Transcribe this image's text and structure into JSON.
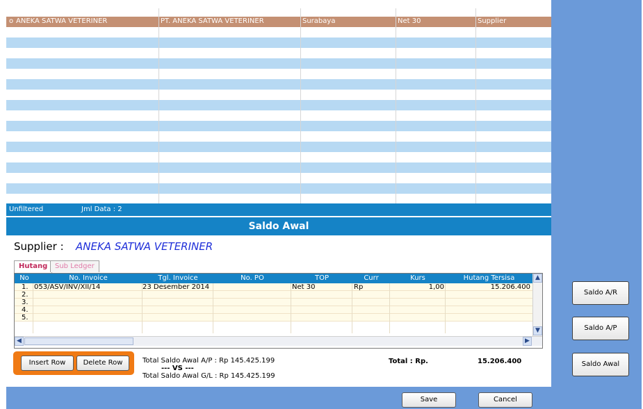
{
  "list": {
    "selected_row": {
      "code": "o",
      "name": "ANEKA SATWA VETERINER",
      "company": "PT. ANEKA SATWA VETERINER",
      "city": "Surabaya",
      "terms": "Net 30",
      "type": "Supplier"
    }
  },
  "status": {
    "filter": "Unfiltered",
    "count_label": "Jml Data : 2"
  },
  "saldo": {
    "title": "Saldo Awal",
    "supplier_label": "Supplier :",
    "supplier_name": "ANEKA SATWA VETERINER",
    "tabs": [
      "Hutang",
      "Sub Ledger"
    ],
    "columns": [
      "No",
      "No. Invoice",
      "Tgl. Invoice",
      "No. PO",
      "TOP",
      "Curr",
      "Kurs",
      "Hutang Tersisa"
    ],
    "rows": [
      {
        "no": "1.",
        "invoice": "053/ASV/INV/XII/14",
        "date": "23 Desember 2014",
        "po": "",
        "top": "Net 30",
        "curr": "Rp",
        "kurs": "1,00",
        "hutang": "15.206.400"
      },
      {
        "no": "2.",
        "invoice": "",
        "date": "",
        "po": "",
        "top": "",
        "curr": "",
        "kurs": "",
        "hutang": ""
      },
      {
        "no": "3.",
        "invoice": "",
        "date": "",
        "po": "",
        "top": "",
        "curr": "",
        "kurs": "",
        "hutang": ""
      },
      {
        "no": "4.",
        "invoice": "",
        "date": "",
        "po": "",
        "top": "",
        "curr": "",
        "kurs": "",
        "hutang": ""
      },
      {
        "no": "5.",
        "invoice": "",
        "date": "",
        "po": "",
        "top": "",
        "curr": "",
        "kurs": "",
        "hutang": ""
      }
    ],
    "insert_row": "Insert Row",
    "delete_row": "Delete Row",
    "total_ap": "Total Saldo Awal A/P : Rp 145.425.199",
    "vs": "--- VS ---",
    "total_gl": "Total Saldo Awal G/L : Rp 145.425.199",
    "total_label": "Total : Rp.",
    "total_value": "15.206.400",
    "save": "Save",
    "cancel": "Cancel"
  },
  "side_buttons": [
    "Saldo A/R",
    "Saldo A/P",
    "Saldo Awal"
  ],
  "colors": {
    "header_blue": "#1583c6",
    "panel_blue": "#6b9ad9",
    "selected_row": "#c49073",
    "stripe": "#b7d9f3",
    "accent_orange": "#f07a14",
    "supplier_text": "#1f2fd9"
  }
}
